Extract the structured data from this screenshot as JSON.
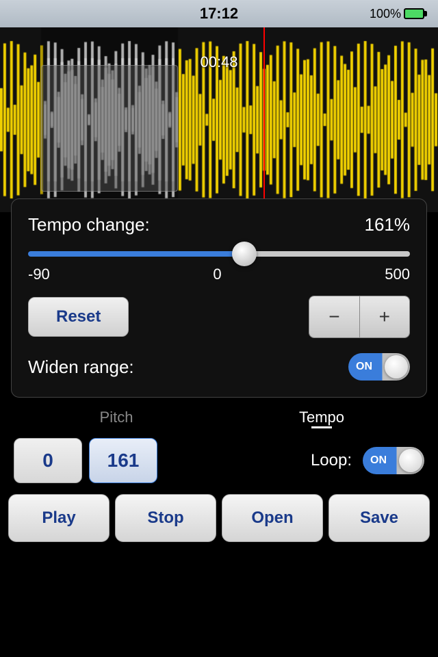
{
  "statusBar": {
    "time": "17:12",
    "battery": "100%"
  },
  "waveform": {
    "currentTime": "00:48"
  },
  "panel": {
    "tempoLabel": "Tempo change:",
    "tempoValue": "161%",
    "sliderMin": "-90",
    "sliderMid": "0",
    "sliderMax": "500",
    "sliderPosition": 57,
    "resetLabel": "Reset",
    "stepperMinus": "−",
    "stepperPlus": "+",
    "widenLabel": "Widen range:",
    "widenToggle": "ON"
  },
  "tabs": {
    "pitch": "Pitch",
    "tempo": "Tempo"
  },
  "controls": {
    "pitchValue": "0",
    "tempoValue": "161",
    "loopLabel": "Loop:",
    "loopToggle": "ON"
  },
  "actions": {
    "play": "Play",
    "stop": "Stop",
    "open": "Open",
    "save": "Save"
  }
}
